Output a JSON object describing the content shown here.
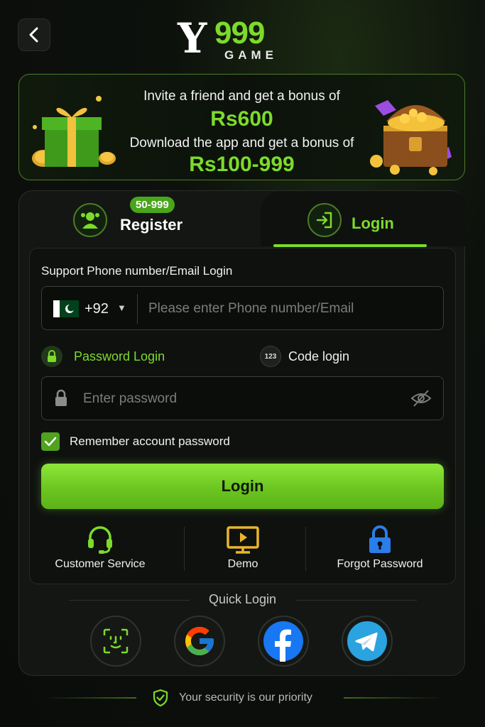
{
  "header": {
    "logo": {
      "y": "Y",
      "num": "999",
      "game": "GAME"
    }
  },
  "banner": {
    "line1": "Invite a friend and get a bonus of",
    "amount1": "Rs600",
    "line2": "Download the app and get a bonus of",
    "amount2": "Rs100-999"
  },
  "tabs": {
    "register": {
      "label": "Register",
      "badge": "50-999"
    },
    "login": {
      "label": "Login"
    }
  },
  "form": {
    "title": "Support Phone number/Email Login",
    "country_code": "+92",
    "phone_placeholder": "Please enter Phone number/Email",
    "password_login_label": "Password Login",
    "code_login_label": "Code login",
    "code_icon_text": "123",
    "password_placeholder": "Enter password",
    "remember_label": "Remember account password",
    "remember_checked": true,
    "login_button": "Login"
  },
  "actions": [
    {
      "label": "Customer Service",
      "icon": "headset-icon"
    },
    {
      "label": "Demo",
      "icon": "play-monitor-icon"
    },
    {
      "label": "Forgot Password",
      "icon": "lock-icon"
    }
  ],
  "quick_login": {
    "title": "Quick Login",
    "options": [
      "face-id-icon",
      "google-icon",
      "facebook-icon",
      "telegram-icon"
    ]
  },
  "footer": {
    "text": "Your security is our priority"
  },
  "colors": {
    "accent": "#7cdb2a",
    "background": "#0a0c0a",
    "card": "#141614"
  }
}
